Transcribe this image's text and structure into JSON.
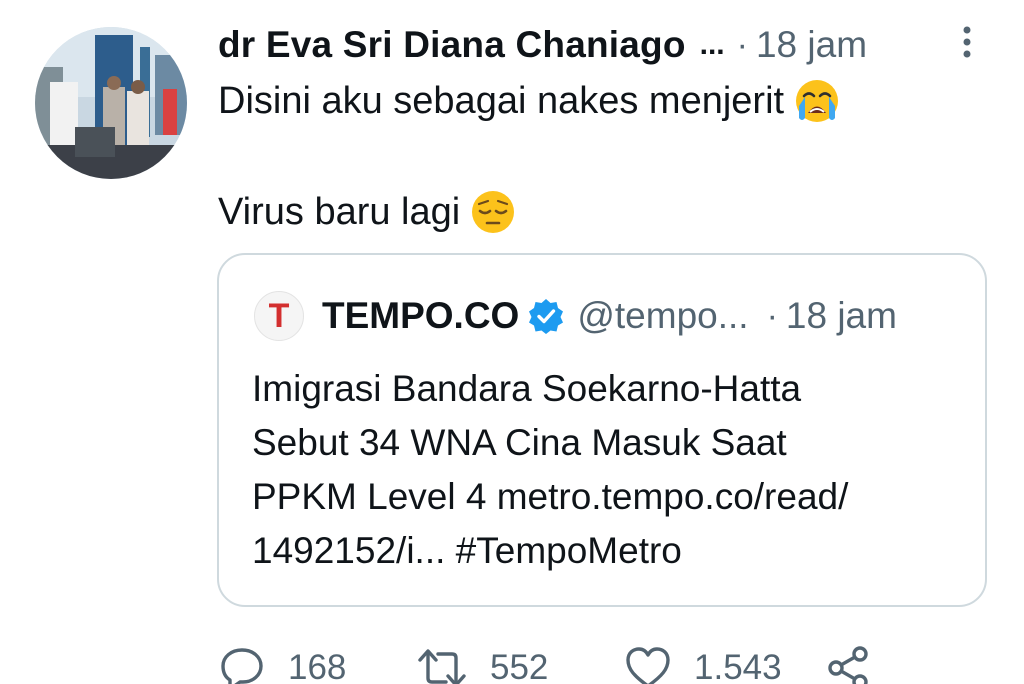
{
  "tweet": {
    "author_name": "dr Eva Sri Diana Chaniago",
    "name_ellipsis": "...",
    "separator": "·",
    "time": "18 jam",
    "text_line_1": "Disini aku sebagai nakes menjerit",
    "text_line_1_emoji": "loudly-crying-face",
    "text_line_2": "Virus baru lagi",
    "text_line_2_emoji": "pensive-face"
  },
  "quote": {
    "logo_letter": "T",
    "name": "TEMPO.CO",
    "handle": "@tempo...",
    "separator": "·",
    "time": "18 jam",
    "lines": [
      "Imigrasi Bandara Soekarno-Hatta",
      "Sebut 34 WNA Cina Masuk Saat",
      "PPKM Level 4 metro.tempo.co/read/",
      "1492152/i... #TempoMetro"
    ]
  },
  "actions": {
    "replies": "168",
    "retweets": "552",
    "likes": "1.543"
  },
  "colors": {
    "text": "#0f1419",
    "secondary": "#536471",
    "border": "#cfd9de",
    "verified": "#1d9bf0",
    "tempo_red": "#d32f2f"
  }
}
